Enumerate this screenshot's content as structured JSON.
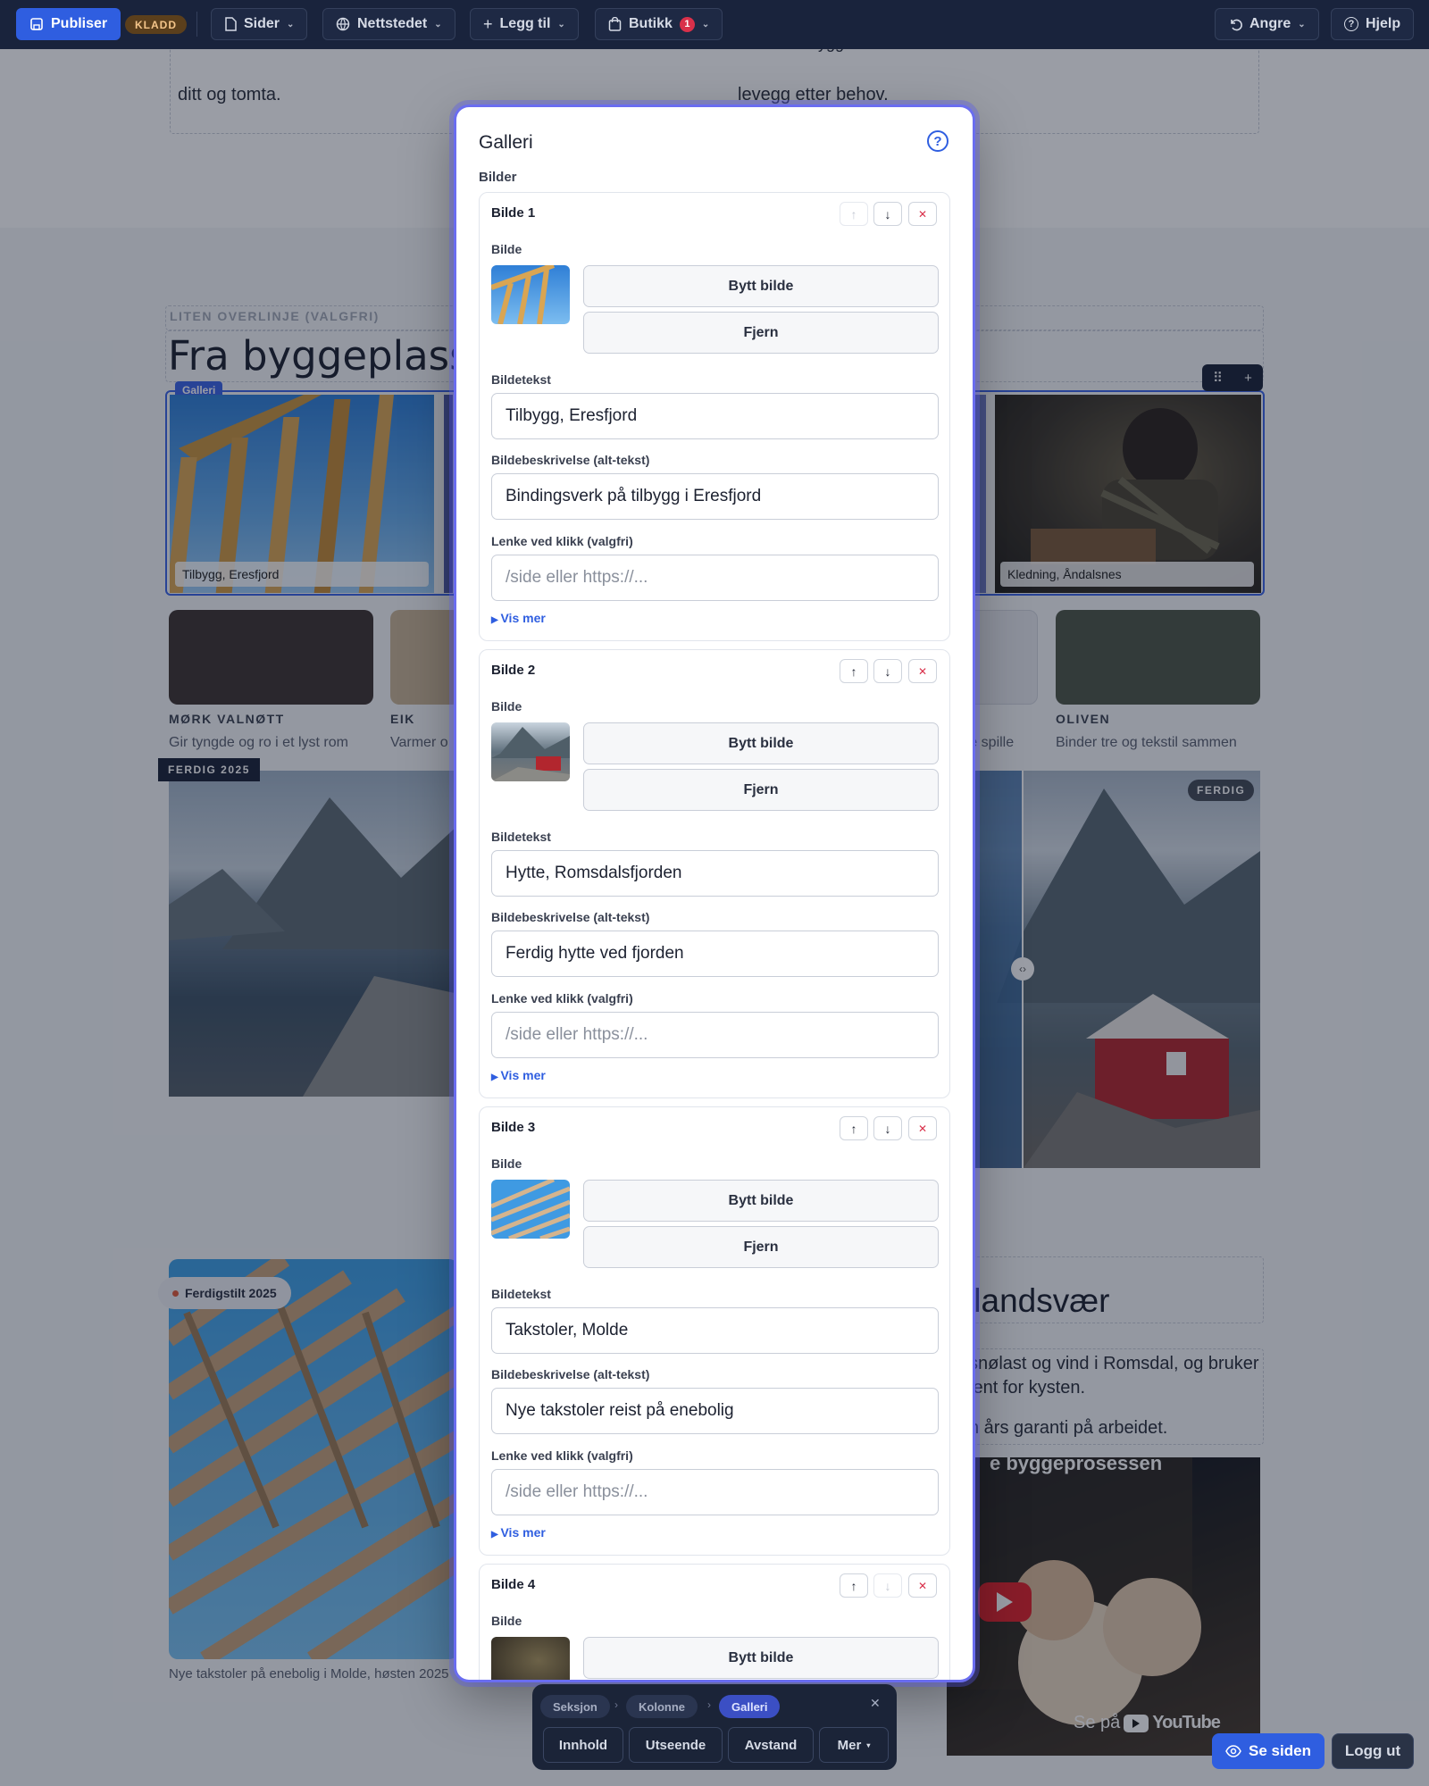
{
  "topbar": {
    "publish": "Publiser",
    "draft_badge": "KLADD",
    "pages": "Sider",
    "website": "Nettstedet",
    "add": "Legg til",
    "shop": "Butikk",
    "shop_count": "1",
    "undo": "Angre",
    "help": "Hjelp"
  },
  "page": {
    "text_left": "ditt og tomta.",
    "text_right": "levegg etter behov.",
    "text_right_partial": "ygg",
    "overline_placeholder": "LITEN OVERLINJE (VALGFRI)",
    "heading": "Fra byggeplassen",
    "gallery_tag": "Galleri",
    "gallery_caption_1": "Tilbygg, Eresfjord",
    "gallery_caption_4": "Kledning, Åndalsnes",
    "swatches": [
      {
        "name": "MØRK VALNØTT",
        "desc": "Gir tyngde og ro i et lyst rom",
        "color": "#3f3431"
      },
      {
        "name": "EIK",
        "desc": "Varmer o",
        "color": "#c8b495"
      },
      {
        "name": "",
        "desc": "re spille",
        "color": "#e7e9ee"
      },
      {
        "name": "OLIVEN",
        "desc": "Binder tre og tekstil sammen",
        "color": "#4e5647"
      }
    ],
    "before_tag": "FERDIG 2025",
    "after_tag": "FERDIG",
    "badge_finished": "Ferdigstilt 2025",
    "heading_2_partial": "tlandsvær",
    "para_1": "snølast og vind i Romsdal, og bruker",
    "para_2": "jent for kysten.",
    "para_3": "n års garanti på arbeidet.",
    "video_title": "e byggeprosessen",
    "video_watch": "Se på",
    "video_brand": "YouTube",
    "bottom_caption": "Nye takstoler på enebolig i Molde, høsten 2025"
  },
  "modal": {
    "title": "Galleri",
    "section_label": "Bilder",
    "field_image": "Bilde",
    "btn_replace": "Bytt bilde",
    "btn_remove": "Fjern",
    "field_caption": "Bildetekst",
    "field_alt": "Bildebeskrivelse (alt-tekst)",
    "field_link": "Lenke ved klikk (valgfri)",
    "show_more": "Vis mer",
    "items": [
      {
        "title": "Bilde 1",
        "caption": "Tilbygg, Eresfjord",
        "alt": "Bindingsverk på tilbygg i Eresfjord",
        "link_placeholder": "/side eller https://..."
      },
      {
        "title": "Bilde 2",
        "caption": "Hytte, Romsdalsfjorden",
        "alt": "Ferdig hytte ved fjorden",
        "link_placeholder": "/side eller https://..."
      },
      {
        "title": "Bilde 3",
        "caption": "Takstoler, Molde",
        "alt": "Nye takstoler reist på enebolig",
        "link_placeholder": "/side eller https://..."
      },
      {
        "title": "Bilde 4"
      }
    ]
  },
  "bottombar": {
    "crumbs": [
      "Seksjon",
      "Kolonne",
      "Galleri"
    ],
    "tabs": [
      "Innhold",
      "Utseende",
      "Avstand",
      "Mer"
    ]
  },
  "corner": {
    "view_site": "Se siden",
    "logout": "Logg ut"
  },
  "colors": {
    "topbar": "#19233c",
    "accent": "#2f5ee0",
    "modal_ring": "#6a6df0",
    "danger": "#d9304a"
  }
}
